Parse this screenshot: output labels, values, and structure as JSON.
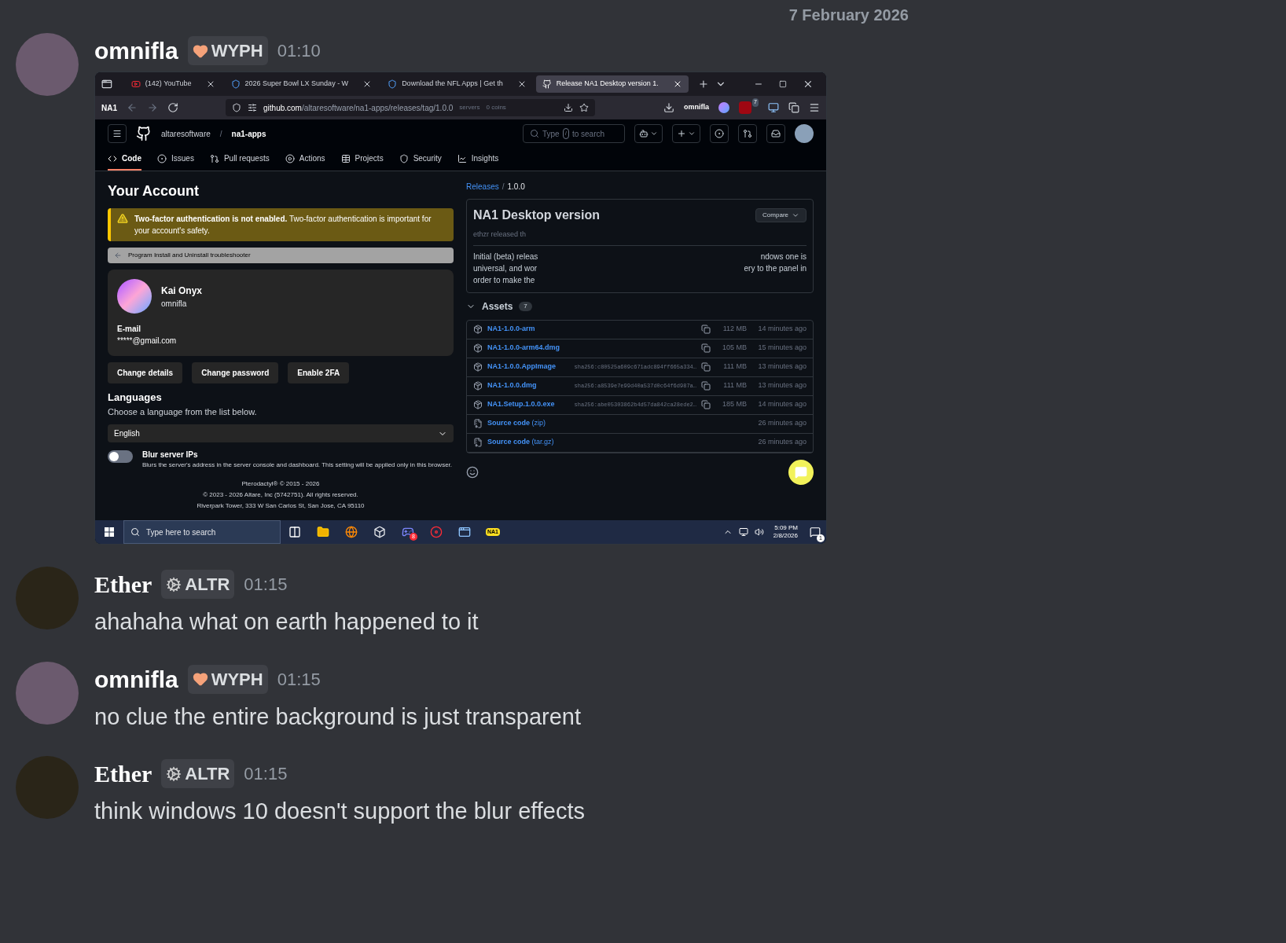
{
  "date_divider": "7 February 2026",
  "messages": [
    {
      "author": "omnifla",
      "badge": {
        "kind": "heart",
        "label": "WYPH"
      },
      "time": "01:10",
      "attachment": {
        "browser": {
          "tabs": [
            {
              "kind": "youtube",
              "title": "(142) YouTube",
              "selected": false
            },
            {
              "kind": "nfl",
              "title": "2026 Super Bowl LX Sunday - W",
              "selected": false
            },
            {
              "kind": "nfl",
              "title": "Download the NFL Apps | Get th",
              "selected": false
            },
            {
              "kind": "github",
              "title": "Release NA1 Desktop version 1.",
              "selected": true
            }
          ],
          "toolbar_logo": "NA1",
          "domain": "github.com",
          "path": "/altaresoftware/na1-apps/releases/tag/1.0.0",
          "servers": "servers",
          "coins": "0 coins",
          "profile": "omnifla",
          "extension_badge": "7"
        },
        "github": {
          "owner": "altaresoftware",
          "separator": "/",
          "repo": "na1-apps",
          "search_before": "Type",
          "search_key": "/",
          "search_after": "to search",
          "nav": [
            {
              "kind": "code",
              "label": "Code",
              "selected": true
            },
            {
              "kind": "issues",
              "label": "Issues",
              "selected": false
            },
            {
              "kind": "pulls",
              "label": "Pull requests",
              "selected": false
            },
            {
              "kind": "actions",
              "label": "Actions",
              "selected": false
            },
            {
              "kind": "projects",
              "label": "Projects",
              "selected": false
            },
            {
              "kind": "security",
              "label": "Security",
              "selected": false
            },
            {
              "kind": "insights",
              "label": "Insights",
              "selected": false
            }
          ],
          "breadcrumb_link": "Releases",
          "breadcrumb_separator": "/",
          "breadcrumb_current": "1.0.0",
          "release": {
            "title": "NA1 Desktop version",
            "author_line": "ethzr released th",
            "body_left": [
              "Initial (beta) releas",
              "universal, and wor",
              "order to make the"
            ],
            "body_right": [
              "ndows one is",
              "ery to the panel in"
            ],
            "compare": "Compare"
          },
          "assets_label": "Assets",
          "assets_count": "7",
          "assets": [
            {
              "kind": "package",
              "name": "NA1-1.0.0-arm",
              "size": "112 MB",
              "time": "14 minutes ago"
            },
            {
              "kind": "package",
              "name": "NA1-1.0.0-arm64.dmg",
              "size": "105 MB",
              "time": "15 minutes ago"
            },
            {
              "kind": "package",
              "name": "NA1-1.0.0.AppImage",
              "hash": "sha256:c80525a609c671adc894ff665a334…",
              "size": "111 MB",
              "time": "13 minutes ago"
            },
            {
              "kind": "package",
              "name": "NA1-1.0.0.dmg",
              "hash": "sha256:a8539e7e99d40a537d0c64f6d987a…",
              "size": "111 MB",
              "time": "13 minutes ago"
            },
            {
              "kind": "package",
              "name": "NA1.Setup.1.0.0.exe",
              "hash": "sha256:abe05303862b4d57da842ca28ede2…",
              "size": "185 MB",
              "time": "14 minutes ago"
            },
            {
              "kind": "source",
              "name": "Source code",
              "suffix": "(zip)",
              "time": "26 minutes ago"
            },
            {
              "kind": "source",
              "name": "Source code",
              "suffix": "(tar.gz)",
              "time": "26 minutes ago"
            }
          ]
        },
        "panel": {
          "title": "Your Account",
          "warning": "**Two-factor authentication is not enabled.** Two-factor authentication is important for your account's safety.",
          "window_title": "Program Install and Uninstall troubleshooter",
          "name": "Kai Onyx",
          "username": "omnifla",
          "email_label": "E-mail",
          "email": "*****@gmail.com",
          "buttons": [
            "Change details",
            "Change password",
            "Enable 2FA"
          ],
          "languages_title": "Languages",
          "languages_description": "Choose a language from the list below.",
          "language": "English",
          "toggle": {
            "label": "Blur server IPs",
            "description": "Blurs the server's address in the server console and dashboard. This setting will be applied only in this browser.",
            "on": false
          },
          "footer": [
            "Pterodactyl® © 2015 - 2026",
            "© 2023 - 2026 Altare, Inc (5742751). All rights reserved.",
            "Riverpark Tower, 333 W San Carlos St, San Jose, CA 95110"
          ]
        },
        "taskbar": {
          "search_placeholder": "Type here to search",
          "apps": [
            {
              "kind": "taskview"
            },
            {
              "kind": "files"
            },
            {
              "kind": "firefox"
            },
            {
              "kind": "roblox"
            },
            {
              "kind": "discord",
              "badge": "8"
            },
            {
              "kind": "media"
            },
            {
              "kind": "window"
            },
            {
              "kind": "na1",
              "label": "NA1"
            }
          ],
          "time": "5:09 PM",
          "date": "2/8/2026",
          "notifications": "1"
        }
      }
    },
    {
      "author": "Ether",
      "badge": {
        "kind": "gear",
        "label": "ALTR"
      },
      "time": "01:15",
      "text": "ahahaha what on earth happened to it"
    },
    {
      "author": "omnifla",
      "badge": {
        "kind": "heart",
        "label": "WYPH"
      },
      "time": "01:15",
      "text": "no clue the entire background is just transparent"
    },
    {
      "author": "Ether",
      "badge": {
        "kind": "gear",
        "label": "ALTR"
      },
      "time": "01:15",
      "text": "think windows 10 doesn't support the blur effects"
    }
  ]
}
